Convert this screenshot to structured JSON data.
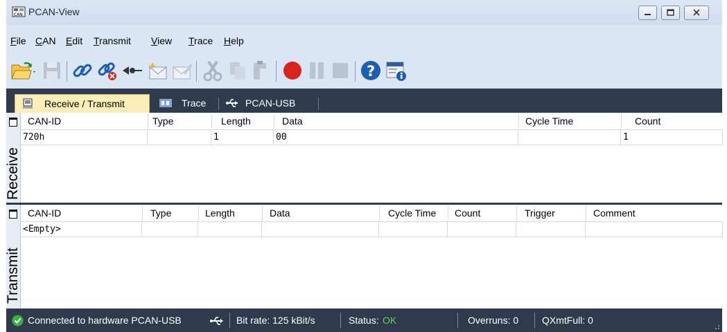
{
  "window": {
    "title": "PCAN-View"
  },
  "menu": [
    {
      "label": "File",
      "mnemonic": "F",
      "rest": "ile"
    },
    {
      "label": "CAN",
      "mnemonic": "C",
      "rest": "AN"
    },
    {
      "label": "Edit",
      "mnemonic": "E",
      "rest": "dit"
    },
    {
      "label": "Transmit",
      "mnemonic": "T",
      "rest": "ransmit"
    },
    {
      "label": "View",
      "mnemonic": "V",
      "rest": "iew"
    },
    {
      "label": "Trace",
      "mnemonic": "T",
      "rest": "race"
    },
    {
      "label": "Help",
      "mnemonic": "H",
      "rest": "elp"
    }
  ],
  "tabs": [
    {
      "label": "Receive / Transmit",
      "active": true
    },
    {
      "label": "Trace",
      "active": false
    },
    {
      "label": "PCAN-USB",
      "active": false
    }
  ],
  "receive": {
    "side_label": "Receive",
    "columns": [
      "CAN-ID",
      "Type",
      "Length",
      "Data",
      "Cycle Time",
      "Count"
    ],
    "rows": [
      {
        "can_id": "720h",
        "type": "",
        "length": "1",
        "data": "00",
        "cycle_time": "",
        "count": "1"
      }
    ]
  },
  "transmit": {
    "side_label": "Transmit",
    "columns": [
      "CAN-ID",
      "Type",
      "Length",
      "Data",
      "Cycle Time",
      "Count",
      "Trigger",
      "Comment"
    ],
    "rows": [
      {
        "can_id": "<Empty>",
        "type": "",
        "length": "",
        "data": "",
        "cycle_time": "",
        "count": "",
        "trigger": "",
        "comment": ""
      }
    ]
  },
  "status": {
    "connection": "Connected to hardware PCAN-USB",
    "bit_rate": "Bit rate: 125 kBit/s",
    "status_label": "Status:",
    "status_value": "OK",
    "overruns": "Overruns: 0",
    "qxmtfull": "QXmtFull: 0"
  },
  "colors": {
    "accent_dark": "#2f3b4d",
    "active_tab": "#fbeeb8",
    "status_ok": "#5fd35f",
    "record_red": "#d9241a",
    "link_blue": "#1a5fb4"
  },
  "icons": [
    "open-icon",
    "save-icon",
    "connect-icon",
    "disconnect-icon",
    "reset-icon",
    "new-message-icon",
    "edit-message-icon",
    "cut-icon",
    "copy-icon",
    "paste-icon",
    "record-icon",
    "pause-icon",
    "stop-icon",
    "help-icon",
    "about-icon"
  ]
}
